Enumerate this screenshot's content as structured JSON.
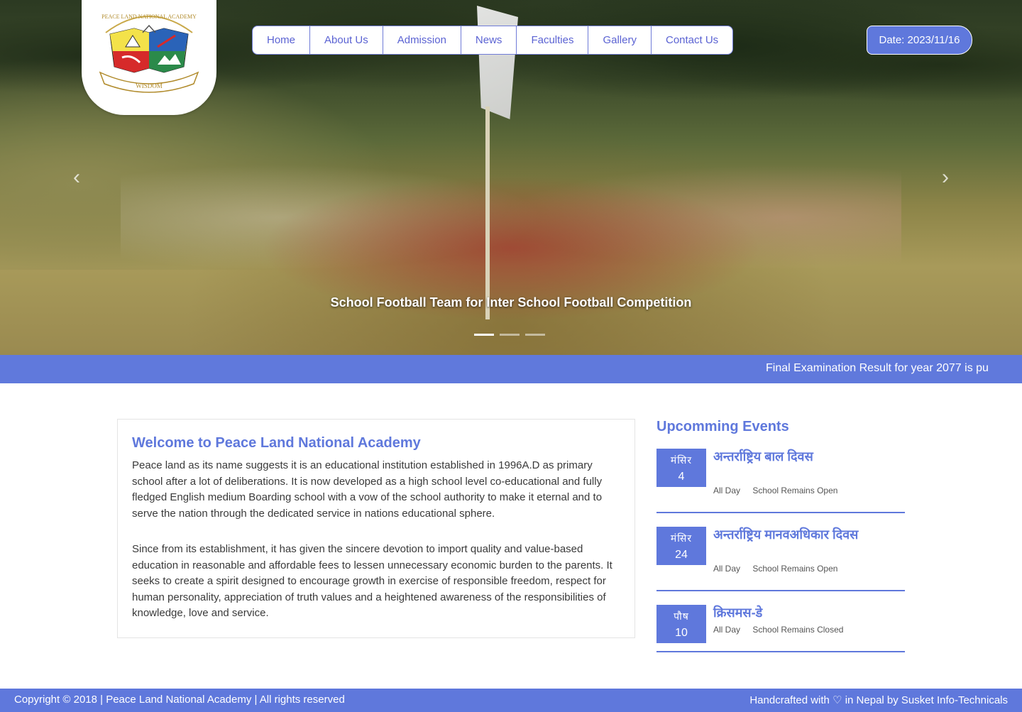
{
  "header": {
    "nav": [
      "Home",
      "About Us",
      "Admission",
      "News",
      "Faculties",
      "Gallery",
      "Contact Us"
    ],
    "date": "Date: 2023/11/16"
  },
  "logo": {
    "text_top": "PEACE LAND NATIONAL ACADEMY",
    "text_bottom": "WISDOM"
  },
  "slider": {
    "caption": "School Football Team for Inter School Football Competition",
    "prev_icon": "chevron-left-icon",
    "next_icon": "chevron-right-icon",
    "slides_count": 3,
    "active_index": 0
  },
  "ticker": {
    "text": "Final Examination Result for year 2077 is pu"
  },
  "welcome": {
    "title": "Welcome to Peace Land National Academy",
    "p1": "Peace land as its name suggests it is an educational institution established in 1996A.D as primary school after a lot of deliberations. It is now developed as a high school level co-educational and fully fledged English medium Boarding school with a vow of the school authority to make it eternal and to serve the nation through the dedicated service in nations educational sphere.",
    "p2": "Since from its establishment, it has given the sincere devotion to import quality and value-based education in reasonable and affordable fees to lessen unnecessary economic burden to the parents. It seeks to create a spirit designed to encourage growth in exercise of responsible freedom, respect for human personality, appreciation of truth values and a heightened awareness of the responsibilities of knowledge, love and service."
  },
  "events": {
    "title": "Upcomming Events",
    "items": [
      {
        "month": "मंसिर",
        "day": "4",
        "title": "अन्तर्राष्ट्रिय बाल दिवस",
        "time": "All Day",
        "status": "School Remains Open"
      },
      {
        "month": "मंसिर",
        "day": "24",
        "title": "अन्तर्राष्ट्रिय मानवअधिकार दिवस",
        "time": "All Day",
        "status": "School Remains Open"
      },
      {
        "month": "पौष",
        "day": "10",
        "title": "क्रिसमस-डे",
        "time": "All Day",
        "status": "School Remains Closed"
      }
    ]
  },
  "footer": {
    "copyright_prefix": "Copyright",
    "copyright_rest": "2018 | Peace Land National Academy | All rights reserved",
    "handcrafted_prefix": "Handcrafted with",
    "handcrafted_rest": "in Nepal by Susket Info-Technicals"
  },
  "colors": {
    "accent": "#5f78dc",
    "nav_text": "#5b63d3"
  }
}
